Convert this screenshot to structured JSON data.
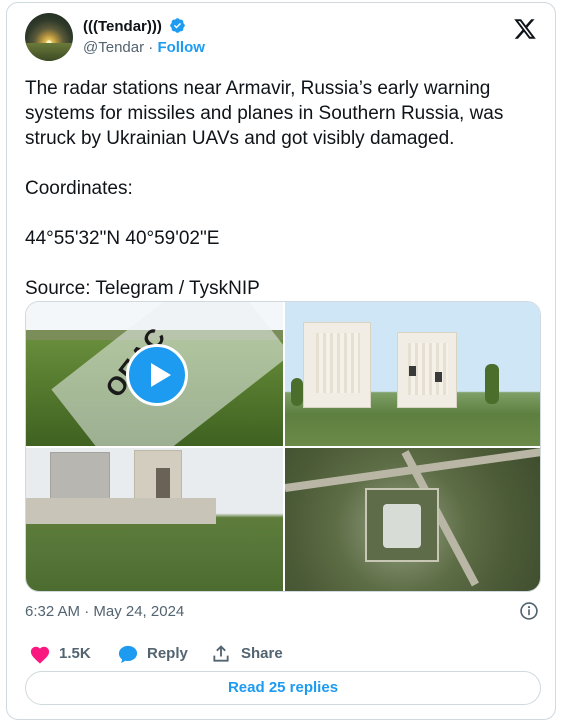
{
  "author": {
    "display_name": "(((Tendar)))",
    "handle": "@Tendar",
    "separator": "·",
    "follow_label": "Follow",
    "verified_icon": "verified-badge-icon"
  },
  "tweet": {
    "text": "The radar stations near Armavir, Russia’s early warning systems for missiles and planes in Southern Russia, was struck by Ukrainian UAVs and got visibly damaged.\n\nCoordinates:\n\n44°55'32\"N 40°59'02\"E\n\nSource: Telegram / TyskNIP"
  },
  "media": {
    "signage_text": "ОПАС",
    "play_icon": "play-icon"
  },
  "meta": {
    "timestamp": "6:32 AM · May 24, 2024"
  },
  "actions": {
    "like_count": "1.5K",
    "reply_label": "Reply",
    "share_label": "Share"
  },
  "footer": {
    "read_replies_label": "Read 25 replies"
  },
  "colors": {
    "accent": "#1d9bf0",
    "like": "#f91880",
    "text_secondary": "#536471"
  }
}
